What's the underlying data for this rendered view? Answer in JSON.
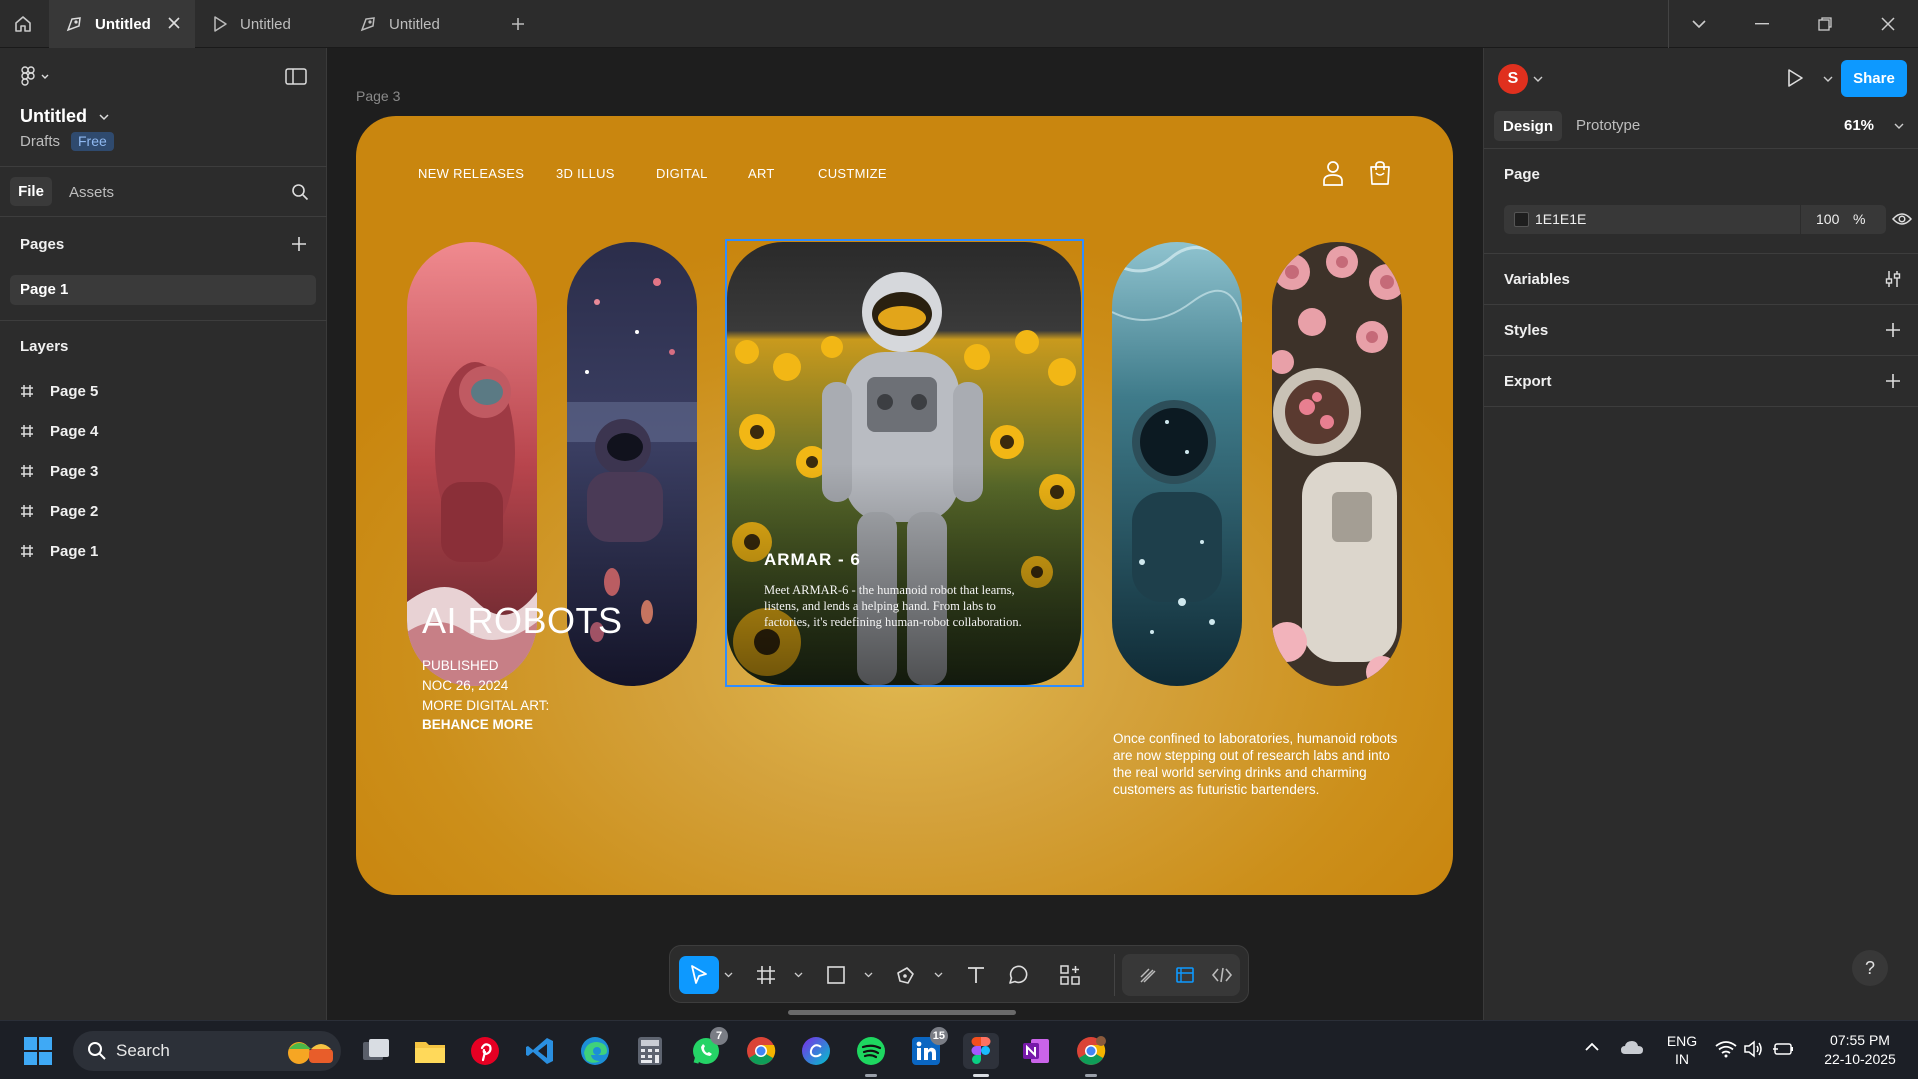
{
  "titlebar": {
    "tabs": [
      {
        "label": "Untitled",
        "active": true
      },
      {
        "label": "Untitled",
        "active": false
      },
      {
        "label": "Untitled",
        "active": false
      }
    ]
  },
  "left_panel": {
    "file_name": "Untitled",
    "location": "Drafts",
    "plan_badge": "Free",
    "tab_file": "File",
    "tab_assets": "Assets",
    "pages_heading": "Pages",
    "current_page": "Page 1",
    "layers_heading": "Layers",
    "layers": [
      "Page 5",
      "Page 4",
      "Page 3",
      "Page 2",
      "Page 1"
    ]
  },
  "canvas": {
    "frame_label": "Page 3",
    "nav": [
      "NEW RELEASES",
      "3D ILLUS",
      "DIGITAL",
      "ART",
      "CUSTMIZE"
    ],
    "hero_title": "ARMAR - 6",
    "hero_desc": "Meet ARMAR-6 - the humanoid robot that learns, listens, and lends a helping hand. From labs to factories, it's redefining human-robot collaboration.",
    "big_title": "AI ROBOTS",
    "meta": {
      "published_label": "PUBLISHED",
      "date": "NOC 26, 2024",
      "more_label": "MORE DIGITAL ART:",
      "link": "BEHANCE MORE"
    },
    "side_desc": "Once confined to laboratories, humanoid robots are now stepping out of research labs and into the real world serving drinks and charming  customers as futuristic bartenders.",
    "colors": {
      "frame": "#cc8f1a",
      "selection": "#2e8dff"
    }
  },
  "right_panel": {
    "avatar_initial": "S",
    "share_label": "Share",
    "tab_design": "Design",
    "tab_prototype": "Prototype",
    "zoom": "61%",
    "page_heading": "Page",
    "page_color": "1E1E1E",
    "page_opacity": "100",
    "percent_sign": "%",
    "variables_heading": "Variables",
    "styles_heading": "Styles",
    "export_heading": "Export",
    "help": "?"
  },
  "taskbar": {
    "search_placeholder": "Search",
    "badges": {
      "whatsapp": "7",
      "linkedin": "15"
    },
    "lang_top": "ENG",
    "lang_bottom": "IN",
    "time": "07:55 PM",
    "date": "22-10-2025"
  }
}
